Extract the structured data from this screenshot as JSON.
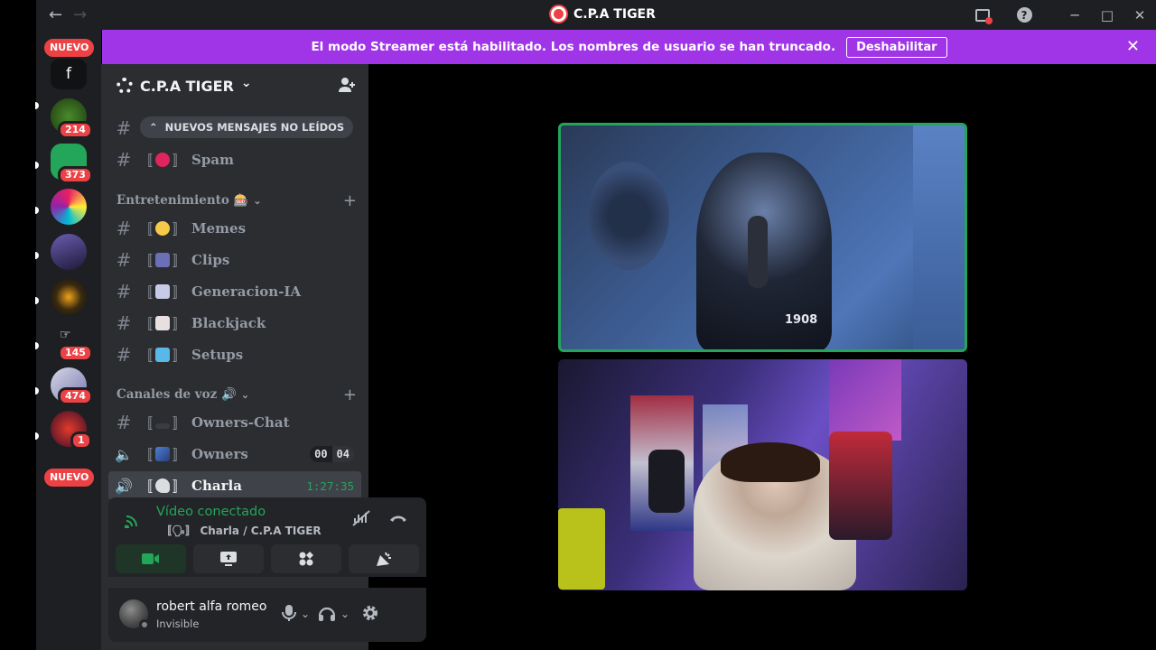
{
  "window": {
    "title": "C.P.A TIGER",
    "nav_back": "←",
    "nav_forward": "→",
    "minimize": "─",
    "maximize": "□",
    "close": "✕",
    "help": "?"
  },
  "banner": {
    "text": "El modo Streamer está habilitado. Los nombres de usuario se han truncado.",
    "button_label": "Deshabilitar",
    "close": "✕"
  },
  "rail": {
    "top_badge": "NUEVO",
    "f_server_label": "f",
    "badges": [
      "214",
      "373",
      "145",
      "474",
      "1"
    ],
    "bottom_badge": "NUEVO"
  },
  "server": {
    "name": "C.P.A TIGER",
    "chevron": "⌄"
  },
  "unread_banner": {
    "label": "NUEVOS MENSAJES NO LEÍDOS",
    "arrow": "^"
  },
  "channels_top": [
    {
      "name": "Spam",
      "emoji_color": "#e0245e"
    }
  ],
  "categories": {
    "entretenimiento": {
      "label": "Entretenimiento 🎰",
      "plus": "+"
    },
    "voz": {
      "label": "Canales de voz 🔊",
      "plus": "+"
    }
  },
  "text_channels": [
    {
      "name": "Memes"
    },
    {
      "name": "Clips"
    },
    {
      "name": "Generacion-IA"
    },
    {
      "name": "Blackjack"
    },
    {
      "name": "Setups"
    }
  ],
  "voice_channels": [
    {
      "name": "Owners-Chat"
    },
    {
      "name": "Owners",
      "counter_a": "00",
      "counter_b": "04"
    },
    {
      "name": "Charla",
      "timer": "1:27:35"
    }
  ],
  "hash_glyph": "#",
  "voice_panel": {
    "status": "Vídeo conectado",
    "location": "Charla / C.P.A TIGER",
    "location_prefix": "〚🗣〛"
  },
  "user": {
    "name": "robert alfa romeo",
    "status": "Invisible"
  },
  "video_tiles": {
    "top_jersey_text": "1908"
  },
  "colors": {
    "streamer_banner": "#a035e8",
    "speaking_ring": "#23a55a",
    "badge_red": "#ed4245",
    "sidebar": "#2b2d31"
  },
  "icons": [
    "back-arrow-icon",
    "forward-arrow-icon",
    "inbox-icon",
    "help-icon",
    "add-member-icon",
    "hash-icon",
    "speaker-icon",
    "camera-icon",
    "screen-share-icon",
    "activities-icon",
    "soundboard-icon",
    "mic-icon",
    "headphones-icon",
    "settings-gear-icon",
    "disconnect-icon",
    "noise-suppression-icon"
  ]
}
